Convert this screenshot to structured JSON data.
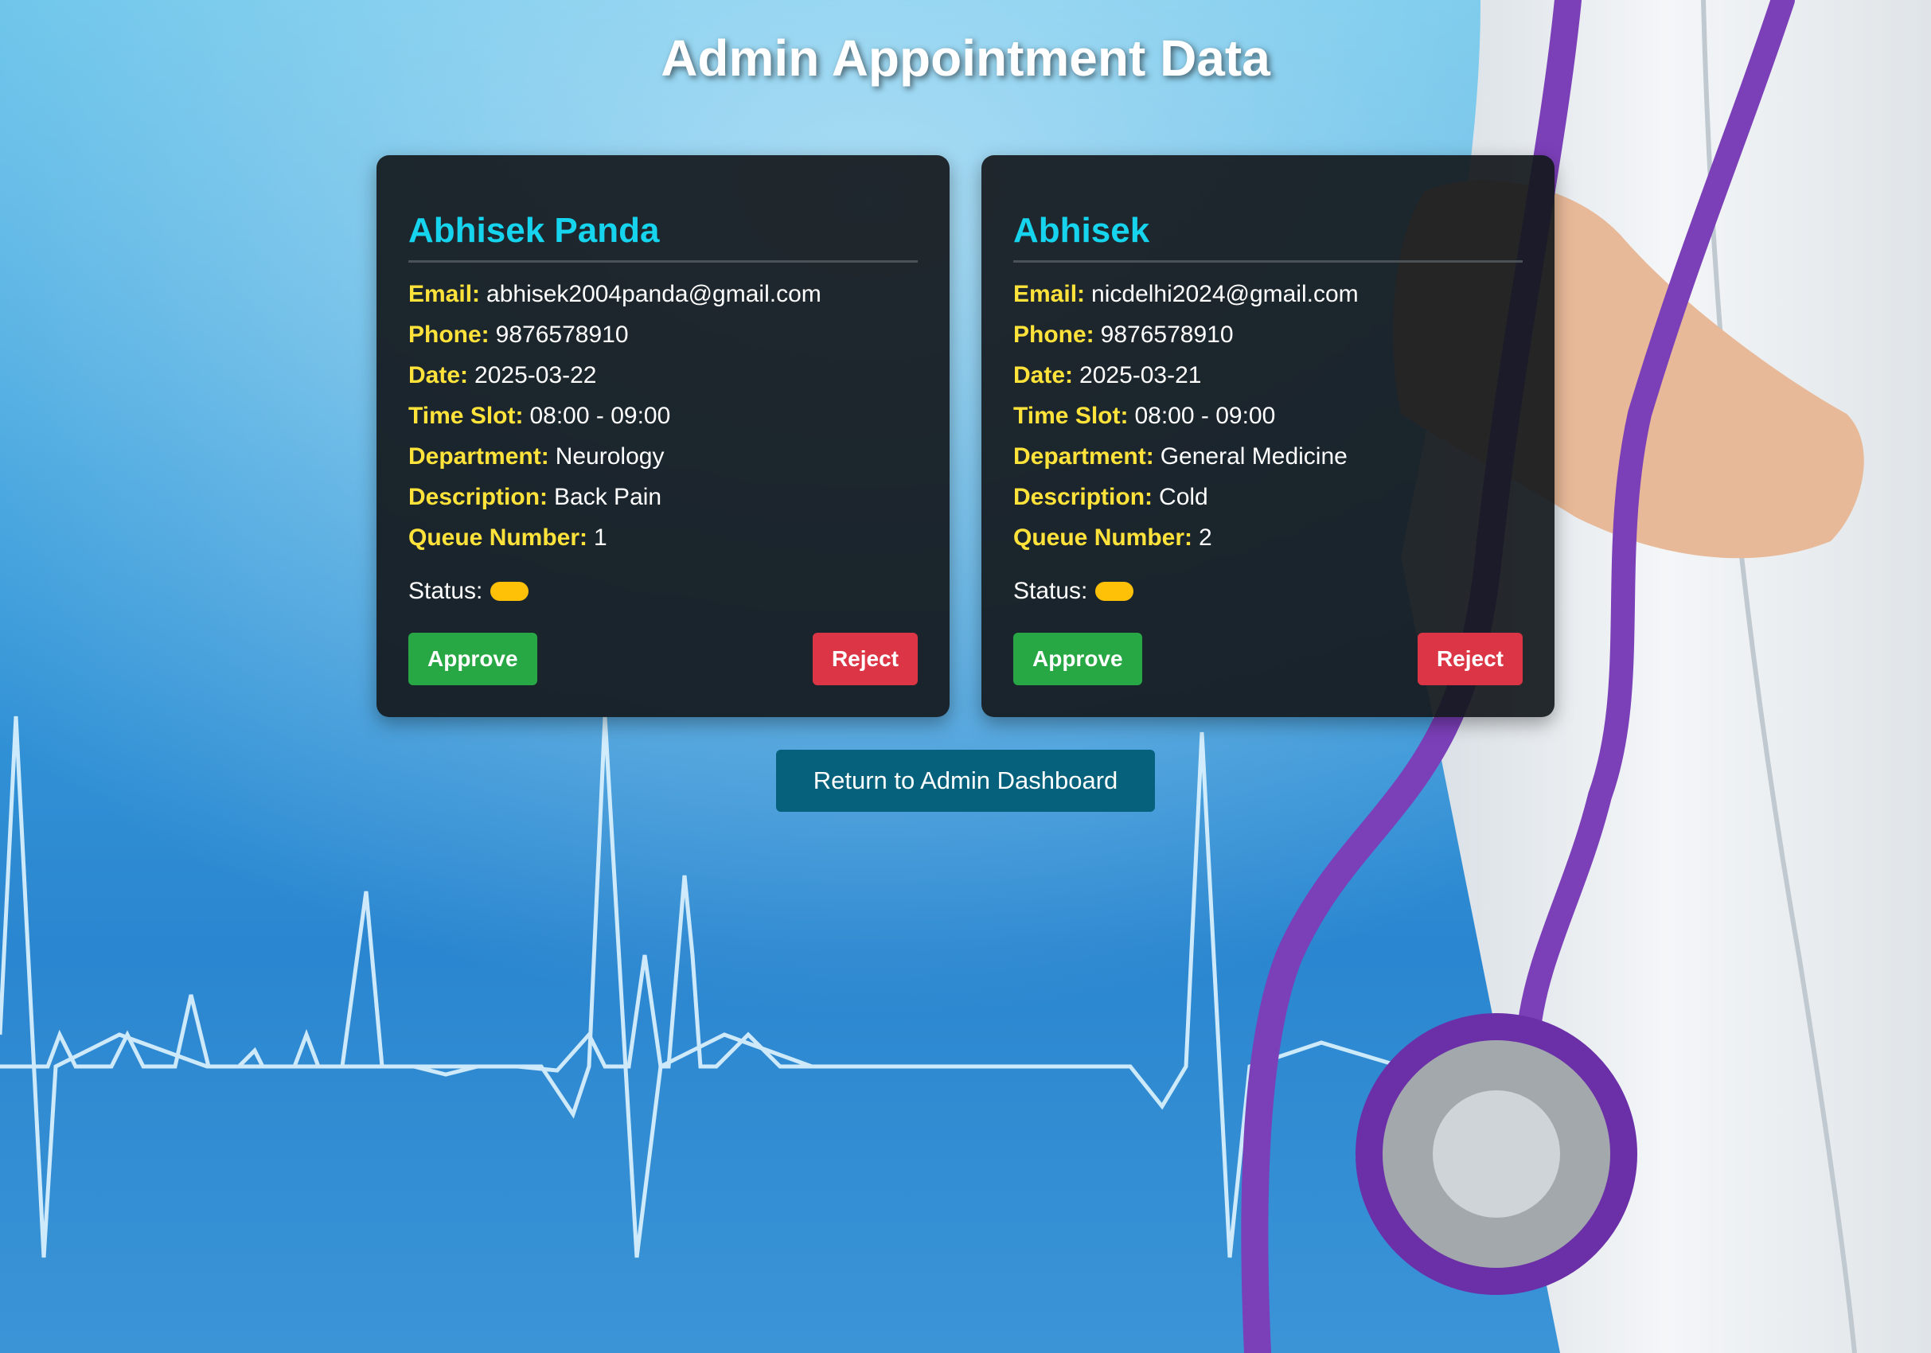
{
  "page": {
    "title": "Admin Appointment Data"
  },
  "labels": {
    "email": "Email:",
    "phone": "Phone:",
    "date": "Date:",
    "time_slot": "Time Slot:",
    "department": "Department:",
    "description": "Description:",
    "queue_number": "Queue Number:",
    "status": "Status:",
    "approve": "Approve",
    "reject": "Reject"
  },
  "appointments": [
    {
      "name": "Abhisek Panda",
      "email": "abhisek2004panda@gmail.com",
      "phone": "9876578910",
      "date": "2025-03-22",
      "time_slot": "08:00 - 09:00",
      "department": "Neurology",
      "description": "Back Pain",
      "queue_number": "1",
      "status_color": "#ffc107"
    },
    {
      "name": "Abhisek",
      "email": "nicdelhi2024@gmail.com",
      "phone": "9876578910",
      "date": "2025-03-21",
      "time_slot": "08:00 - 09:00",
      "department": "General Medicine",
      "description": "Cold",
      "queue_number": "2",
      "status_color": "#ffc107"
    }
  ],
  "return_button": {
    "label": "Return to Admin Dashboard"
  },
  "colors": {
    "card_bg": "#14181c",
    "name": "#16d4ee",
    "label": "#ffe33a",
    "approve": "#28a745",
    "reject": "#dc3545",
    "return": "#06627c",
    "status_pending": "#ffc107"
  }
}
